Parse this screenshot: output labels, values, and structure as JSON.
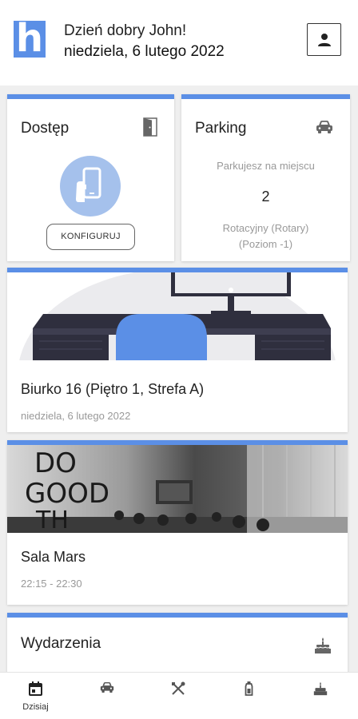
{
  "header": {
    "logo_letter": "h",
    "greeting": "Dzień dobry John!",
    "date": "niedziela, 6 lutego 2022"
  },
  "access_card": {
    "title": "Dostęp",
    "button_label": "KONFIGURUJ"
  },
  "parking_card": {
    "title": "Parking",
    "label": "Parkujesz na miejscu",
    "spot_number": "2",
    "type": "Rotacyjny (Rotary)",
    "level": "(Poziom -1)"
  },
  "desk_card": {
    "title": "Biurko 16 (Piętro 1, Strefa A)",
    "date": "niedziela, 6 lutego 2022"
  },
  "room_card": {
    "title": "Sala Mars",
    "time": "22:15 - 22:30",
    "wall_text": [
      "DO",
      "GOOD",
      "TH"
    ]
  },
  "events_card": {
    "title": "Wydarzenia"
  },
  "bottom_nav": {
    "items": [
      {
        "label": "Dzisiaj",
        "icon": "calendar-icon",
        "active": true
      },
      {
        "label": "",
        "icon": "car-icon",
        "active": false
      },
      {
        "label": "",
        "icon": "cutlery-icon",
        "active": false
      },
      {
        "label": "",
        "icon": "bottle-icon",
        "active": false
      },
      {
        "label": "",
        "icon": "cake-icon",
        "active": false
      }
    ]
  },
  "colors": {
    "accent": "#5b8fe6",
    "accent_light": "#a5c1ec",
    "desk_dark": "#2f2f3e",
    "text_muted": "#999999"
  }
}
